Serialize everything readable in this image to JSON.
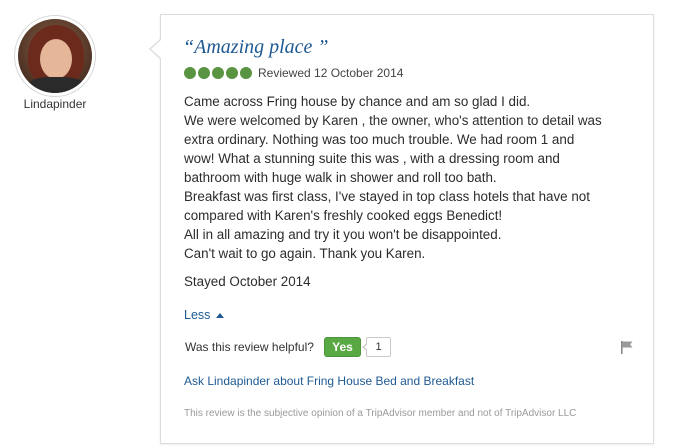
{
  "reviewer": {
    "username": "Lindapinder"
  },
  "review": {
    "title": "“Amazing place ”",
    "rating": 5,
    "rating_max": 5,
    "reviewed_date": "Reviewed 12 October 2014",
    "body_lines": [
      "Came across Fring house by chance and am so glad I did.",
      "We were welcomed by Karen , the owner, who's attention to detail was",
      "extra ordinary. Nothing was too much trouble. We had room 1 and",
      "wow! What a stunning suite this was , with a dressing room and",
      "bathroom with huge walk in shower and roll too bath.",
      "Breakfast was first class, I've stayed in top class hotels that have not",
      "compared with Karen's freshly cooked eggs Benedict!",
      "All in all amazing and try it you won't be disappointed.",
      "Can't wait to go again. Thank you Karen."
    ],
    "stayed": "Stayed October 2014",
    "less_label": "Less",
    "helpful_question": "Was this review helpful?",
    "yes_label": "Yes",
    "helpful_count": "1",
    "ask_link": "Ask Lindapinder about Fring House Bed and Breakfast",
    "disclaimer": "This review is the subjective opinion of a TripAdvisor member and not of TripAdvisor LLC"
  },
  "colors": {
    "link": "#1f5a93",
    "rating_green": "#589442",
    "yes_button": "#58a943"
  },
  "icons": {
    "flag": "flag-icon",
    "caret": "caret-up-icon",
    "rating_bubble": "rating-bubble-icon"
  }
}
